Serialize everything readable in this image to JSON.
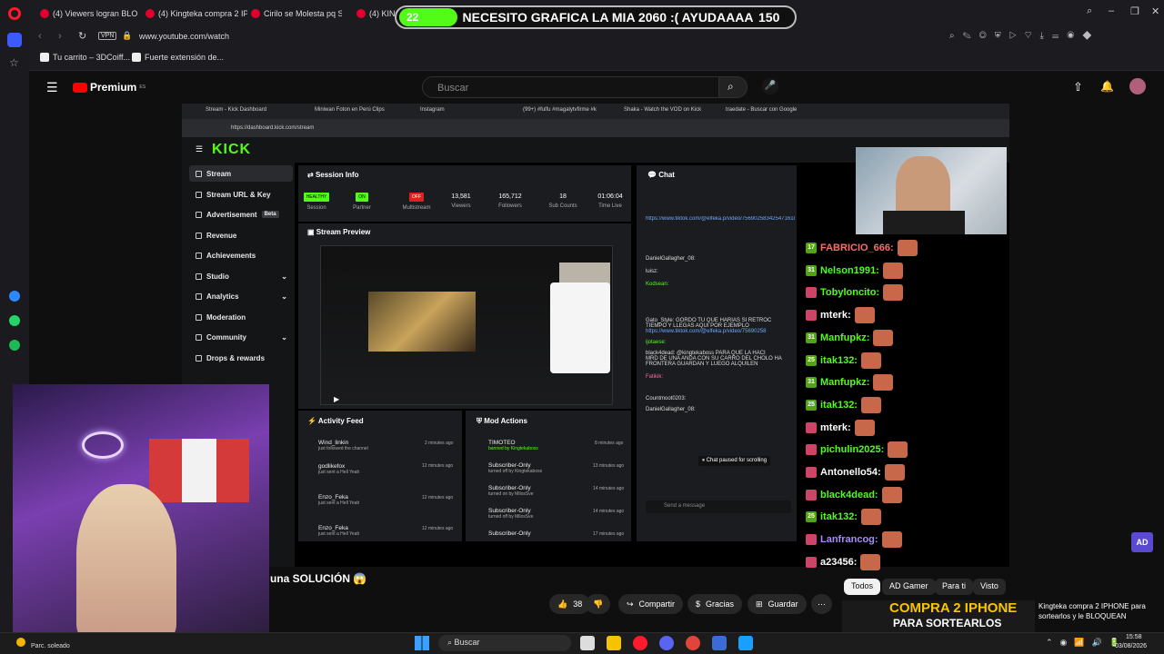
{
  "browser": {
    "tabs": [
      {
        "label": "(4) Viewers logran BLO"
      },
      {
        "label": "(4) Kingteka compra 2 IPH"
      },
      {
        "label": "Cirilo se Molesta pq Su"
      },
      {
        "label": "(4) KINGT"
      }
    ],
    "address": "www.youtube.com/watch",
    "vpn_label": "VPN",
    "bookmarks": [
      "Tu carrito – 3DCoiff...",
      "Fuerte extensión de..."
    ]
  },
  "overlay": {
    "count": "22",
    "message": "NECESITO GRAFICA LA MIA 2060 :( AYUDAAAA",
    "number": "150"
  },
  "youtube": {
    "logo_text": "Premium",
    "region": "ES",
    "search_placeholder": "Buscar",
    "video_title": "una SOLUCIÓN 😱",
    "likes": "38",
    "share_label": "Compartir",
    "thanks_label": "Gracias",
    "save_label": "Guardar",
    "chips": [
      "Todos",
      "AD Gamer",
      "Para ti",
      "Visto"
    ],
    "rec_title": "Kingteka compra 2 IPHONE para sortearlos y le BLOQUEAN",
    "rec_thumb_text": "COMPRA 2 IPHONE",
    "rec_thumb_text2": "PARA SORTEARLOS"
  },
  "inner_browser": {
    "tabs": [
      "Stream - Kick Dashboard",
      "Miniwan Foton en Perú Clips",
      "Instagram",
      "(99+) #fulfu #magalytvfirme #k",
      "Shaka - Watch the VOD on Kick",
      "traedate - Buscar con Google"
    ],
    "address": "https://dashboard.kick.com/stream"
  },
  "kick": {
    "logo": "KICK",
    "nav": [
      "Stream",
      "Stream URL & Key",
      "Advertisement",
      "Revenue",
      "Achievements",
      "Studio",
      "Analytics",
      "Moderation",
      "Community",
      "Drops & rewards"
    ],
    "beta": "Beta",
    "session_title": "Session Info",
    "session": [
      {
        "value": "HEALTHY",
        "label": "Session"
      },
      {
        "value": "ON",
        "label": "Partner"
      },
      {
        "value": "OFF",
        "label": "Multistream"
      },
      {
        "value": "13,581",
        "label": "Viewers"
      },
      {
        "value": "165,712",
        "label": "Followers"
      },
      {
        "value": "18",
        "label": "Sub Counts"
      },
      {
        "value": "01:06:04",
        "label": "Time Live"
      }
    ],
    "preview_title": "Stream Preview",
    "activity_title": "Activity Feed",
    "activity": [
      {
        "name": "Wind_linkin",
        "desc": "just followed the channel",
        "time": "2 minutes ago"
      },
      {
        "name": "godlikefox",
        "desc": "just sent a Hell Yeah",
        "time": "12 minutes ago"
      },
      {
        "name": "Enzo_Feka",
        "desc": "just sent a Hell Yeah",
        "time": "12 minutes ago"
      },
      {
        "name": "Enzo_Feka",
        "desc": "just sent a Hell Yeah",
        "time": "12 minutes ago"
      }
    ],
    "mod_title": "Mod Actions",
    "mods": [
      {
        "name": "TIMOTEO",
        "desc": "banned by Kingtekaboss",
        "time": "8 minutes ago"
      },
      {
        "name": "Subscriber-Only",
        "desc": "turned off by Kingtekaboss",
        "time": "13 minutes ago"
      },
      {
        "name": "Subscriber-Only",
        "desc": "turned on by MilosSve",
        "time": "14 minutes ago"
      },
      {
        "name": "Subscriber-Only",
        "desc": "turned off by MilosSve",
        "time": "14 minutes ago"
      },
      {
        "name": "Subscriber-Only",
        "desc": "",
        "time": "17 minutes ago"
      }
    ],
    "chat_title": "Chat",
    "chat_lines": [
      "https://www.tiktok.com/@elfeka.p/video/7569025834254716182",
      "DanielGallagher_08:",
      "luisz:",
      "Kodsean:",
      "Gato_Style: GORDO TU QUE HARIAS SI RETROC",
      "TIEMPO Y LLEGAS AQUI POR EJEMPLO",
      "https://www.tiktok.com/@elfeka.p/video/75690258",
      "ijotaese:",
      "black4dead: @kingtekaboss PARA QUE LA HACI",
      "MRD DE UNA ANDA CON SU CARRO DEL CHOLO HA",
      "FRONTERA GUARDAN Y LUEGO ALQUILEN",
      "Fatikik:",
      "Countmoot0203:",
      "DanielGallagher_08:"
    ],
    "chat_paused": "Chat paused for scrolling",
    "send_placeholder": "Send a message"
  },
  "big_chat": [
    {
      "badge": "17",
      "name": "FABRICIO_666:",
      "color": "#ff6b6b"
    },
    {
      "badge": "31",
      "name": "Nelson1991:",
      "color": "#53fc18"
    },
    {
      "badge": "",
      "name": "Tobyloncito:",
      "color": "#53fc18"
    },
    {
      "badge": "",
      "name": "mterk:",
      "color": "#ffffff"
    },
    {
      "badge": "31",
      "name": "Manfupkz:",
      "color": "#53fc18"
    },
    {
      "badge": "25",
      "name": "itak132:",
      "color": "#53fc18"
    },
    {
      "badge": "31",
      "name": "Manfupkz:",
      "color": "#53fc18"
    },
    {
      "badge": "25",
      "name": "itak132:",
      "color": "#53fc18"
    },
    {
      "badge": "",
      "name": "mterk:",
      "color": "#ffffff"
    },
    {
      "badge": "",
      "name": "pichulin2025:",
      "color": "#53fc18"
    },
    {
      "badge": "",
      "name": "Antonello54:",
      "color": "#ffffff"
    },
    {
      "badge": "",
      "name": "black4dead:",
      "color": "#53fc18"
    },
    {
      "badge": "25",
      "name": "itak132:",
      "color": "#53fc18"
    },
    {
      "badge": "",
      "name": "Lanfrancog:",
      "color": "#a78bfa"
    },
    {
      "badge": "",
      "name": "a23456:",
      "color": "#ffffff"
    }
  ],
  "taskbar": {
    "weather": "Parc. soleado",
    "search": "Buscar",
    "time": "15:58",
    "date": "03/08/2026"
  },
  "colors": {
    "kick_green": "#53fc18",
    "yt_red": "#ff0000",
    "opera_red": "#ff1b2d"
  }
}
